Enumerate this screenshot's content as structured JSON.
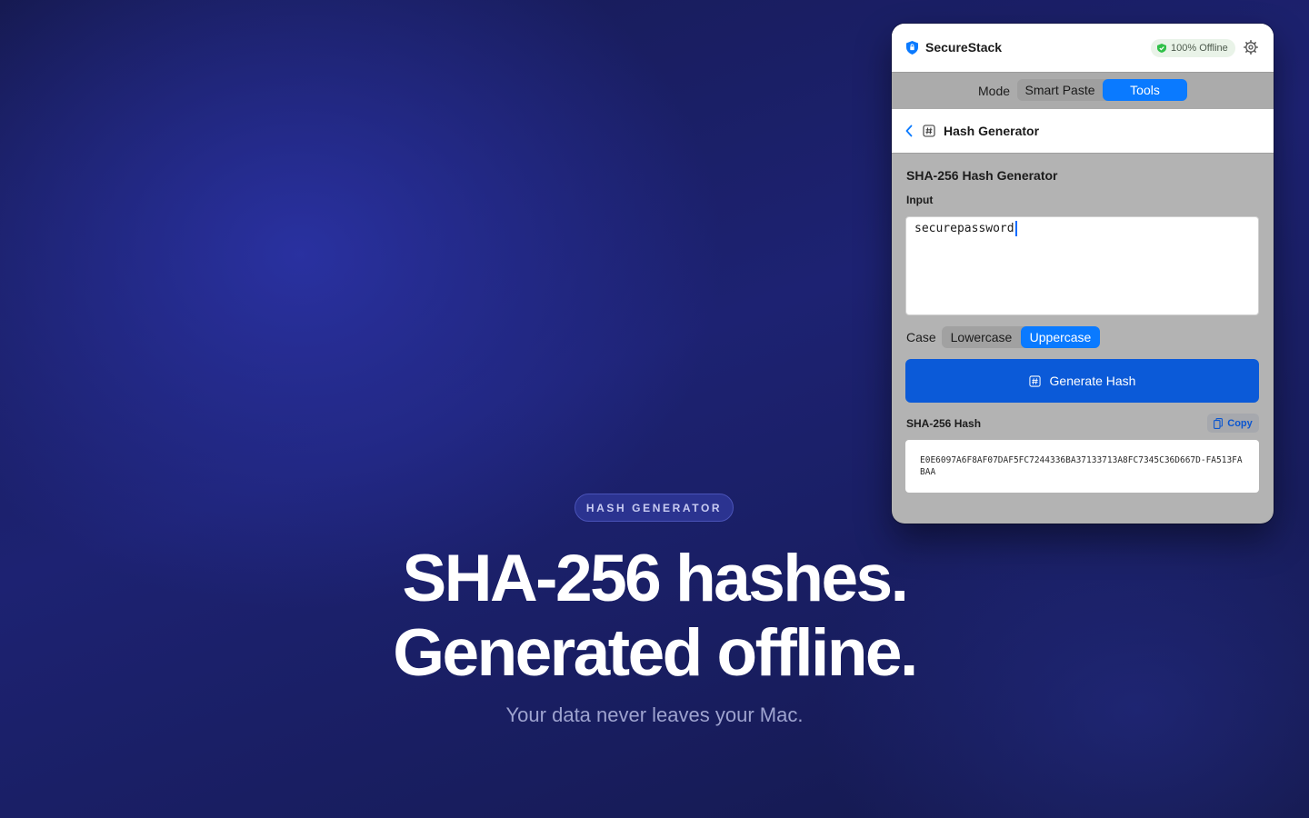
{
  "hero": {
    "badge": "HASH GENERATOR",
    "headline_line1": "SHA-256 hashes.",
    "headline_line2": "Generated offline.",
    "subline": "Your data never leaves your Mac."
  },
  "window": {
    "app_name": "SecureStack",
    "status_badge": "100% Offline",
    "mode": {
      "label": "Mode",
      "options": [
        "Smart Paste",
        "Tools"
      ],
      "selected": "Tools"
    },
    "nav": {
      "title": "Hash Generator"
    },
    "tool": {
      "section_title": "SHA-256 Hash Generator",
      "input_label": "Input",
      "input_value": "securepassword",
      "case": {
        "label": "Case",
        "options": [
          "Lowercase",
          "Uppercase"
        ],
        "selected": "Uppercase"
      },
      "generate_button": "Generate Hash",
      "output_label": "SHA-256 Hash",
      "copy_button": "Copy",
      "output_value": "E0E6097A6F8AF07DAF5FC7244336BA37133713A8FC7345C36D667D-FA513FABAA"
    }
  },
  "colors": {
    "accent": "#0a7aff",
    "primary_button": "#0b5ad8",
    "offline_green": "#30c048"
  },
  "icons": [
    "shield-icon",
    "check-shield-icon",
    "gear-icon",
    "chevron-left-icon",
    "hash-icon",
    "copy-icon"
  ]
}
